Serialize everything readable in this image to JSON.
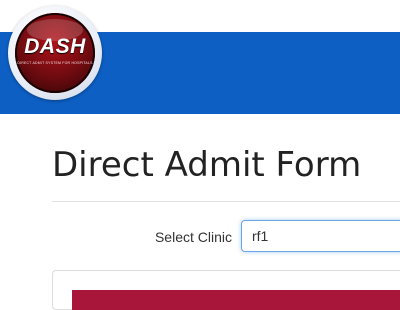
{
  "header": {
    "logo": {
      "word": "DASH",
      "tagline": "DIRECT ADMIT SYSTEM FOR HOSPITALS"
    },
    "bar_color": "#0d5fc4"
  },
  "main": {
    "title": "Direct Admit Form",
    "clinic": {
      "label": "Select Clinic",
      "value": "rf1"
    },
    "panel_heading_color": "#a8173a"
  }
}
